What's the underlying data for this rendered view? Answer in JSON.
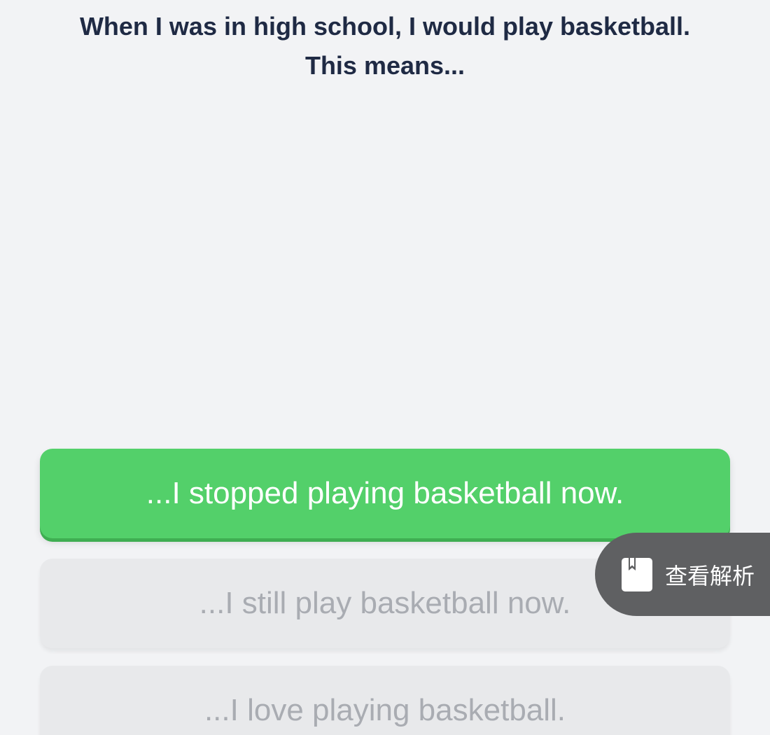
{
  "question": {
    "line1": "When I was in high school, I would play basketball.",
    "line2": "This means..."
  },
  "options": [
    {
      "label": "...I stopped playing basketball now.",
      "state": "correct"
    },
    {
      "label": "...I still play basketball now.",
      "state": "muted"
    },
    {
      "label": "...I love playing basketball.",
      "state": "muted"
    }
  ],
  "explain_button": {
    "label": "查看解析",
    "icon": "bookmark-book-icon"
  },
  "colors": {
    "background": "#f2f3f5",
    "correct": "#53d06a",
    "muted_bg": "#e8e9eb",
    "muted_text": "#a9acb2",
    "question_text": "#1f2a44",
    "explain_bg": "#5f6062"
  }
}
